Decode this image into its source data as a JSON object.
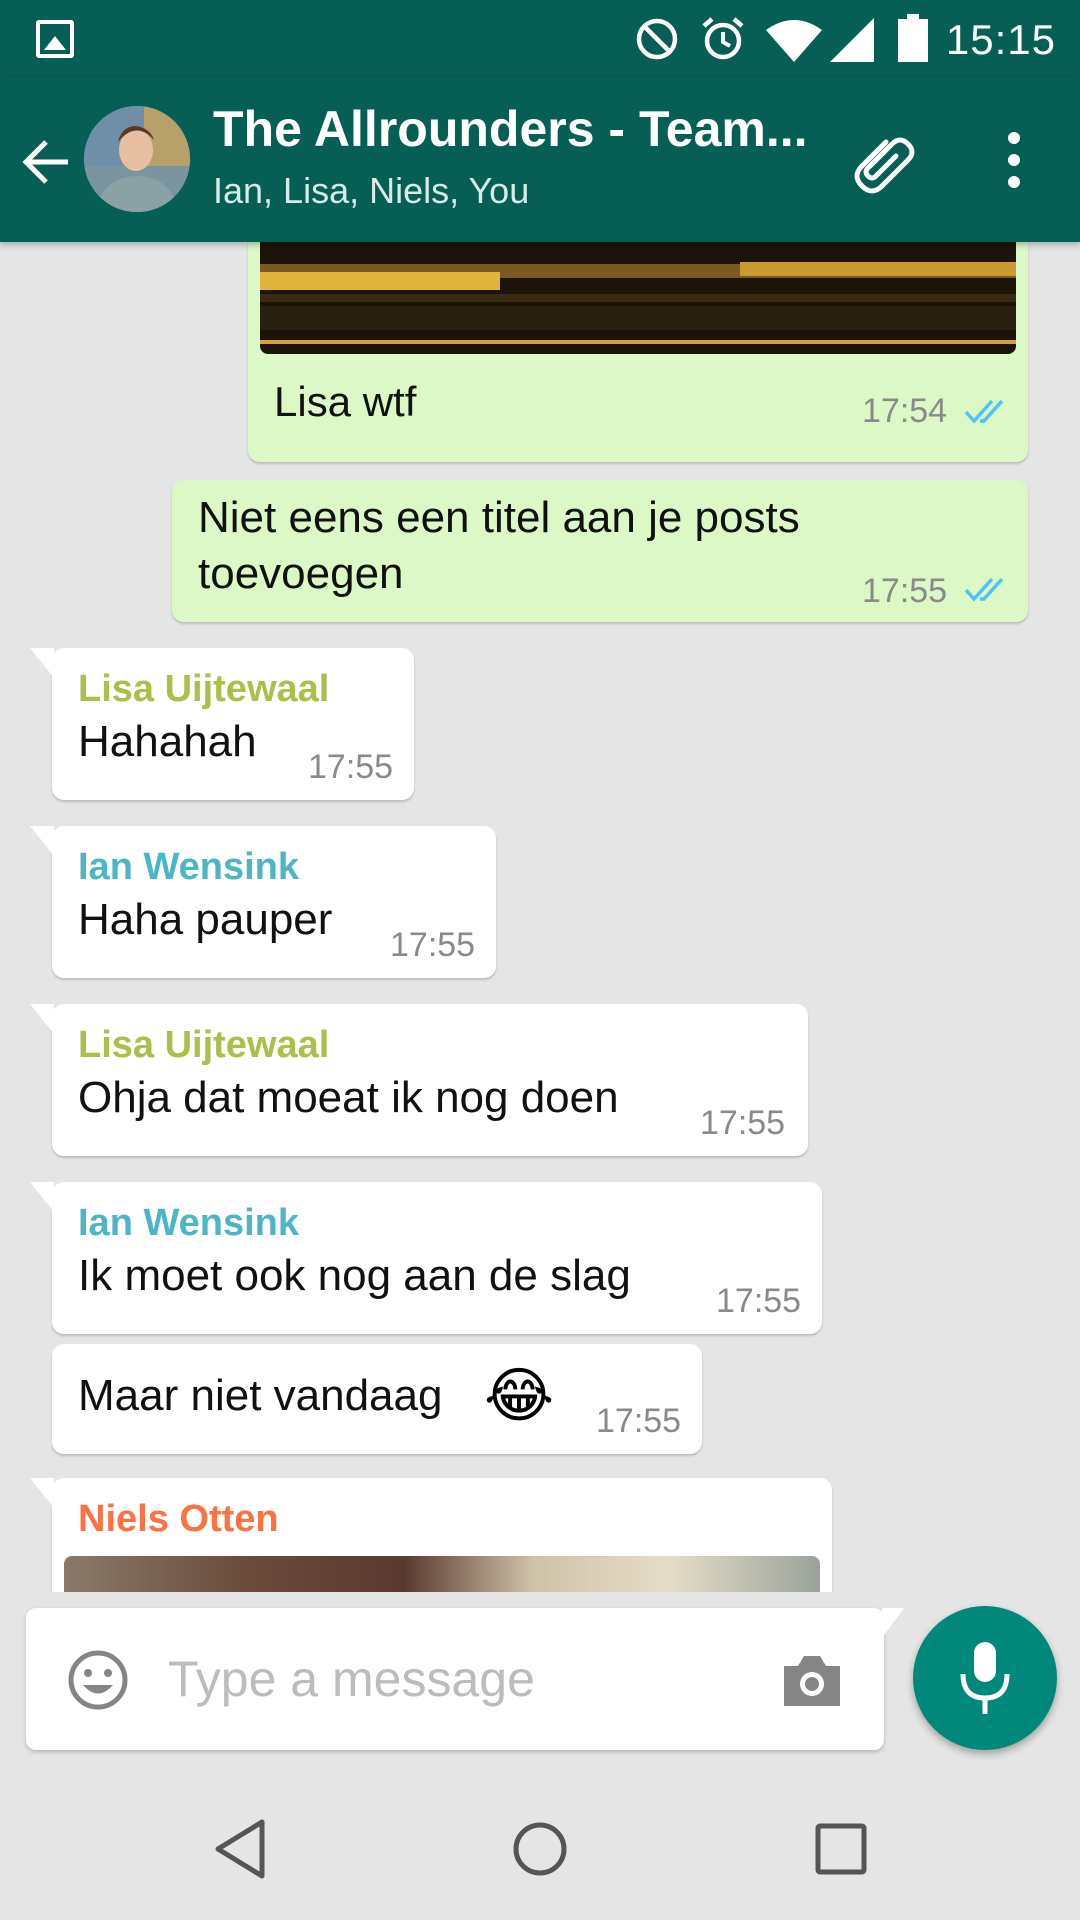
{
  "status_bar": {
    "time": "15:15"
  },
  "header": {
    "title": "The Allrounders - Team...",
    "participants": "Ian, Lisa, Niels, You"
  },
  "colors": {
    "header_bg": "#075e54",
    "outgoing_bubble": "#dcf8c6",
    "incoming_bubble": "#ffffff",
    "sender_lisa": "#a9c04a",
    "sender_ian": "#4db6c4",
    "sender_niels": "#ff7043",
    "read_ticks": "#4fc3f7",
    "mic_button": "#00897b"
  },
  "messages": [
    {
      "type": "outgoing-image",
      "caption": "Lisa wtf",
      "time": "17:54",
      "status": "read"
    },
    {
      "type": "outgoing",
      "text_line1": "Niet eens een titel aan je posts",
      "text_line2": "toevoegen",
      "time": "17:55",
      "status": "read"
    },
    {
      "type": "incoming",
      "sender": "Lisa Uijtewaal",
      "text": "Hahahah",
      "time": "17:55"
    },
    {
      "type": "incoming",
      "sender": "Ian Wensink",
      "text": "Haha pauper",
      "time": "17:55"
    },
    {
      "type": "incoming",
      "sender": "Lisa Uijtewaal",
      "text": "Ohja dat moeat ik nog doen",
      "time": "17:55"
    },
    {
      "type": "incoming",
      "sender": "Ian Wensink",
      "text": "Ik moet ook nog aan de slag",
      "time": "17:55"
    },
    {
      "type": "incoming-continuation",
      "text": "Maar niet vandaag",
      "emoji": "😂",
      "time": "17:55"
    },
    {
      "type": "incoming-image",
      "sender": "Niels Otten"
    }
  ],
  "composer": {
    "placeholder": "Type a message"
  }
}
